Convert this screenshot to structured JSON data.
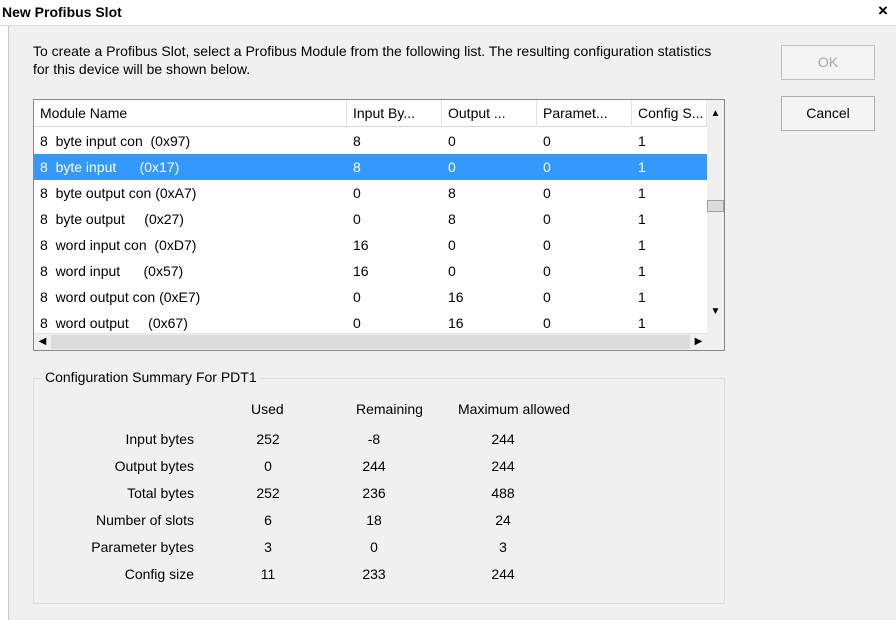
{
  "window": {
    "title": "New Profibus Slot",
    "close_glyph": "×"
  },
  "instructions": "To create a Profibus Slot, select a Profibus Module from the following list. The resulting configuration statistics for this device will be shown below.",
  "buttons": {
    "ok": "OK",
    "cancel": "Cancel"
  },
  "module_list": {
    "columns": [
      "Module Name",
      "Input By...",
      "Output ...",
      "Paramet...",
      "Config S..."
    ],
    "rows": [
      {
        "name": "8  byte input con  (0x97)",
        "input": "8",
        "output": "0",
        "param": "0",
        "config": "1"
      },
      {
        "name": "8  byte input      (0x17)",
        "input": "8",
        "output": "0",
        "param": "0",
        "config": "1",
        "selected": true
      },
      {
        "name": "8  byte output con (0xA7)",
        "input": "0",
        "output": "8",
        "param": "0",
        "config": "1"
      },
      {
        "name": "8  byte output     (0x27)",
        "input": "0",
        "output": "8",
        "param": "0",
        "config": "1"
      },
      {
        "name": "8  word input con  (0xD7)",
        "input": "16",
        "output": "0",
        "param": "0",
        "config": "1"
      },
      {
        "name": "8  word input      (0x57)",
        "input": "16",
        "output": "0",
        "param": "0",
        "config": "1"
      },
      {
        "name": "8  word output con (0xE7)",
        "input": "0",
        "output": "16",
        "param": "0",
        "config": "1"
      },
      {
        "name": "8  word output     (0x67)",
        "input": "0",
        "output": "16",
        "param": "0",
        "config": "1"
      }
    ]
  },
  "summary": {
    "title": "Configuration Summary For PDT1",
    "headers": [
      "Used",
      "Remaining",
      "Maximum allowed"
    ],
    "rows": [
      {
        "label": "Input bytes",
        "used": "252",
        "remaining": "-8",
        "max": "244"
      },
      {
        "label": "Output bytes",
        "used": "0",
        "remaining": "244",
        "max": "244"
      },
      {
        "label": "Total bytes",
        "used": "252",
        "remaining": "236",
        "max": "488"
      },
      {
        "label": "Number of slots",
        "used": "6",
        "remaining": "18",
        "max": "24"
      },
      {
        "label": "Parameter bytes",
        "used": "3",
        "remaining": "0",
        "max": "3"
      },
      {
        "label": "Config size",
        "used": "11",
        "remaining": "233",
        "max": "244"
      }
    ]
  },
  "colors": {
    "selection": "#3399ff",
    "dialog_bg": "#f0f0f0"
  }
}
